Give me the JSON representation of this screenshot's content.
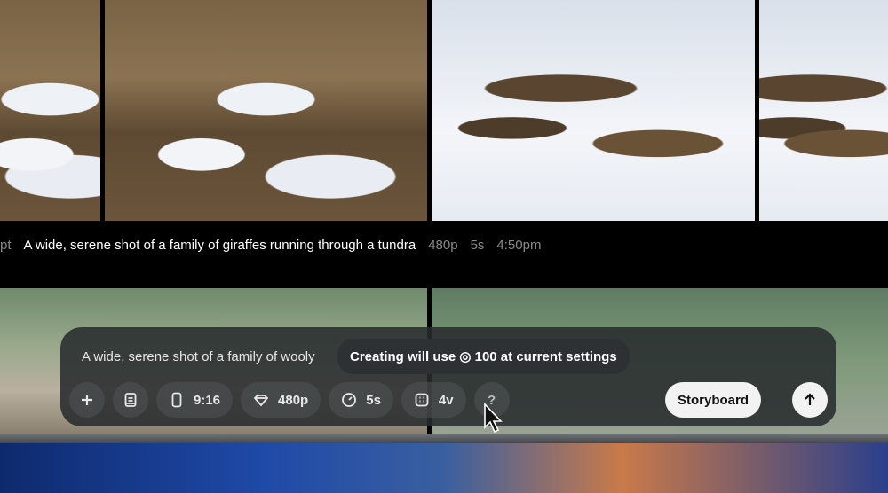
{
  "caption": {
    "prefix": "pt",
    "prompt": "A wide, serene shot of a family of giraffes running through a tundra",
    "resolution": "480p",
    "duration": "5s",
    "time": "4:50pm"
  },
  "composer": {
    "prompt_text": "A wide, serene shot of a family of wooly",
    "tooltip": "Creating will use ◎ 100 at current settings",
    "add_icon": "plus-icon",
    "aspect_ratio": "9:16",
    "resolution": "480p",
    "duration": "5s",
    "variations": "4v",
    "help": "?",
    "storyboard_label": "Storyboard",
    "submit_icon": "arrow-up-icon"
  }
}
